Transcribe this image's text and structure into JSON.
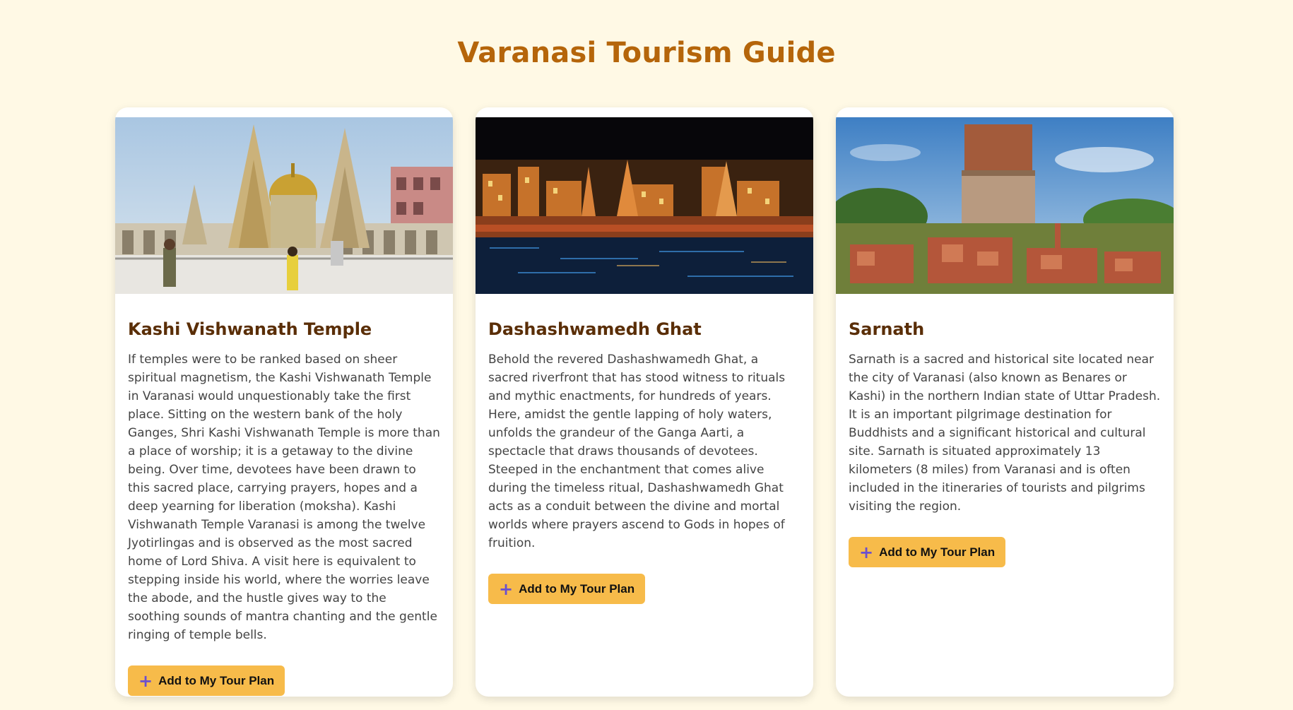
{
  "page": {
    "title": "Varanasi Tourism Guide"
  },
  "cards": [
    {
      "title": "Kashi Vishwanath Temple",
      "description": "If temples were to be ranked based on sheer spiritual magnetism, the Kashi Vishwanath Temple in Varanasi would unquestionably take the first place. Sitting on the western bank of the holy Ganges, Shri Kashi Vishwanath Temple is more than a place of worship; it is a getaway to the divine being. Over time, devotees have been drawn to this sacred place, carrying prayers, hopes and a deep yearning for liberation (moksha). Kashi Vishwanath Temple Varanasi is among the twelve Jyotirlingas and is observed as the most sacred home of Lord Shiva. A visit here is equivalent to stepping inside his world, where the worries leave the abode, and the hustle gives way to the soothing sounds of mantra chanting and the gentle ringing of temple bells.",
      "button_label": "Add to My Tour Plan",
      "button_icon": "plus-icon"
    },
    {
      "title": "Dashashwamedh Ghat",
      "description": "Behold the revered Dashashwamedh Ghat, a sacred riverfront that has stood witness to rituals and mythic enactments, for hundreds of years. Here, amidst the gentle lapping of holy waters, unfolds the grandeur of the Ganga Aarti, a spectacle that draws thousands of devotees. Steeped in the enchantment that comes alive during the timeless ritual, Dashashwamedh Ghat acts as a conduit between the divine and mortal worlds where prayers ascend to Gods in hopes of fruition.",
      "button_label": "Add to My Tour Plan",
      "button_icon": "plus-icon"
    },
    {
      "title": "Sarnath",
      "description": "Sarnath is a sacred and historical site located near the city of Varanasi (also known as Benares or Kashi) in the northern Indian state of Uttar Pradesh. It is an important pilgrimage destination for Buddhists and a significant historical and cultural site. Sarnath is situated approximately 13 kilometers (8 miles) from Varanasi and is often included in the itineraries of tourists and pilgrims visiting the region.",
      "button_label": "Add to My Tour Plan",
      "button_icon": "plus-icon"
    }
  ],
  "colors": {
    "background": "#fff9e5",
    "title": "#b5650a",
    "card_title": "#5a2e07",
    "button": "#f7bb4a",
    "plus_icon": "#6a4fcf"
  }
}
